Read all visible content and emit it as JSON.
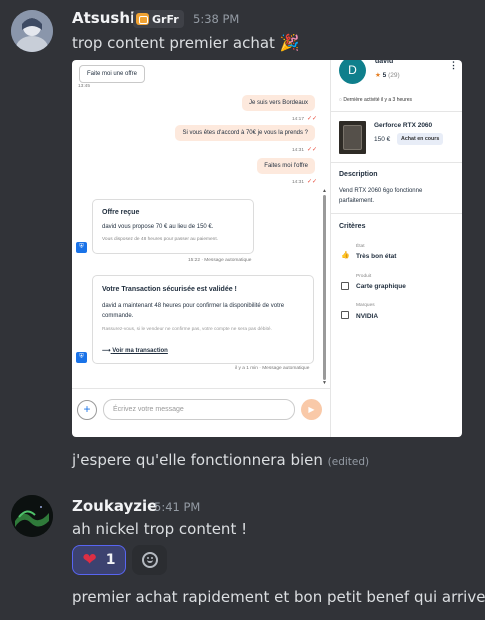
{
  "messages": [
    {
      "author": "Atsushi",
      "tag": "GrFr",
      "time": "5:38 PM",
      "text": "trop content premier achat",
      "emoji": "🎉",
      "followup": "j'espere qu'elle fonctionnera bien",
      "edited": "(edited)"
    },
    {
      "author": "Zoukayzie",
      "time": "5:41 PM",
      "text": "ah nickel trop content !",
      "reaction": {
        "emoji": "❤️",
        "count": "1"
      },
      "followup": "premier achat rapidement et bon petit benef qui arrive"
    }
  ],
  "screenshot": {
    "chat": {
      "offer_button": "Faite moi une offre",
      "offer_time": "13:45",
      "bubbles": [
        {
          "text": "Je suis vers Bordeaux",
          "time": "14:17"
        },
        {
          "text": "Si vous êtes d'accord à 70€ je vous la prends ?",
          "time": "14:31"
        },
        {
          "text": "Faites moi l'offre",
          "time": "14:31"
        }
      ],
      "offer_card": {
        "title": "Offre reçue",
        "line1": "david vous propose 70 € au lieu de 150 €.",
        "line2": "Vous disposez de 48 heures pour passer au paiement.",
        "footer": "15:22 · Message automatique"
      },
      "transaction_card": {
        "title": "Votre Transaction sécurisée est validée !",
        "line1": "david a maintenant 48 heures pour confirmer la disponibilité de votre commande.",
        "line2": "Rassurez-vous, si le vendeur ne confirme pas, votre compte ne sera pas débité.",
        "link": "Voir ma transaction",
        "footer": "il y a 1 min · Message automatique"
      },
      "input_placeholder": "Écrivez votre message"
    },
    "sidebar": {
      "avatar_letter": "D",
      "seller": "david",
      "rating": "5",
      "rating_count": "(29)",
      "last_activity": "Dernière activité il y a 3 heures",
      "product_title": "Gerforce RTX 2060",
      "price": "150 €",
      "status_badge": "Achat en cours",
      "description_title": "Description",
      "description": "Vend RTX 2060 6go fonctionne parfaitement.",
      "criteria_title": "Critères",
      "criteria": [
        {
          "label": "État",
          "value": "Très bon état"
        },
        {
          "label": "Produit",
          "value": "Carte graphique"
        },
        {
          "label": "Marques",
          "value": "NVIDIA"
        }
      ]
    }
  }
}
